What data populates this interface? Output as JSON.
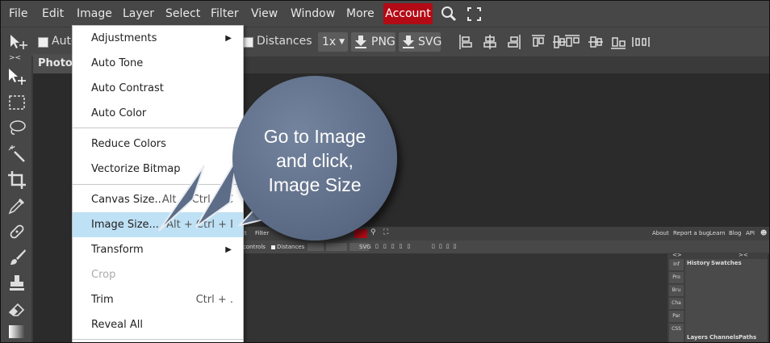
{
  "menubar": {
    "items": [
      "File",
      "Edit",
      "Image",
      "Layer",
      "Select",
      "Filter",
      "View",
      "Window",
      "More"
    ],
    "account_label": "Account"
  },
  "toolbar": {
    "auto_select_label": "Auto",
    "distances_label": "Distances",
    "zoom_label": "1x",
    "png_label": "PNG",
    "svg_label": "SVG"
  },
  "doc_tab": {
    "title": "Photop"
  },
  "image_menu": {
    "items": [
      {
        "label": "Adjustments",
        "shortcut": "",
        "submenu": true,
        "disabled": false
      },
      {
        "label": "Auto Tone",
        "shortcut": "",
        "submenu": false,
        "disabled": false
      },
      {
        "label": "Auto Contrast",
        "shortcut": "",
        "submenu": false,
        "disabled": false
      },
      {
        "label": "Auto Color",
        "shortcut": "",
        "submenu": false,
        "disabled": false
      },
      {
        "label": "Reduce Colors",
        "shortcut": "",
        "submenu": false,
        "disabled": false
      },
      {
        "label": "Vectorize Bitmap",
        "shortcut": "",
        "submenu": false,
        "disabled": false
      },
      {
        "label": "Canvas Size...",
        "shortcut": "Alt + Ctrl + C",
        "submenu": false,
        "disabled": false
      },
      {
        "label": "Image Size...",
        "shortcut": "Alt + Ctrl + I",
        "submenu": false,
        "disabled": false,
        "highlighted": true
      },
      {
        "label": "Transform",
        "shortcut": "",
        "submenu": true,
        "disabled": false
      },
      {
        "label": "Crop",
        "shortcut": "",
        "submenu": false,
        "disabled": true
      },
      {
        "label": "Trim",
        "shortcut": "Ctrl + .",
        "submenu": false,
        "disabled": false
      },
      {
        "label": "Reveal All",
        "shortcut": "",
        "submenu": false,
        "disabled": false
      }
    ]
  },
  "callout": {
    "line1": "Go to Image",
    "line2": "and click,",
    "line3": "Image Size"
  },
  "mini_screenshot": {
    "menu_left": [
      "ct",
      "Filter"
    ],
    "menu_right": [
      "About",
      "Report a bug",
      "Learn",
      "Blog",
      "API"
    ],
    "tool_text": [
      "controls",
      "Distances",
      "SVG"
    ],
    "side_tabs": [
      "Inf",
      "Pro",
      "Bru",
      "Cha",
      "Par",
      "CSS"
    ],
    "panel_tabs": [
      "History",
      "Swatches"
    ],
    "bottom_tabs": [
      "Layers",
      "Channels",
      "Paths"
    ]
  },
  "colors": {
    "accent": "#b30b16",
    "highlight": "#bfe1f5",
    "callout": "#65748e"
  }
}
